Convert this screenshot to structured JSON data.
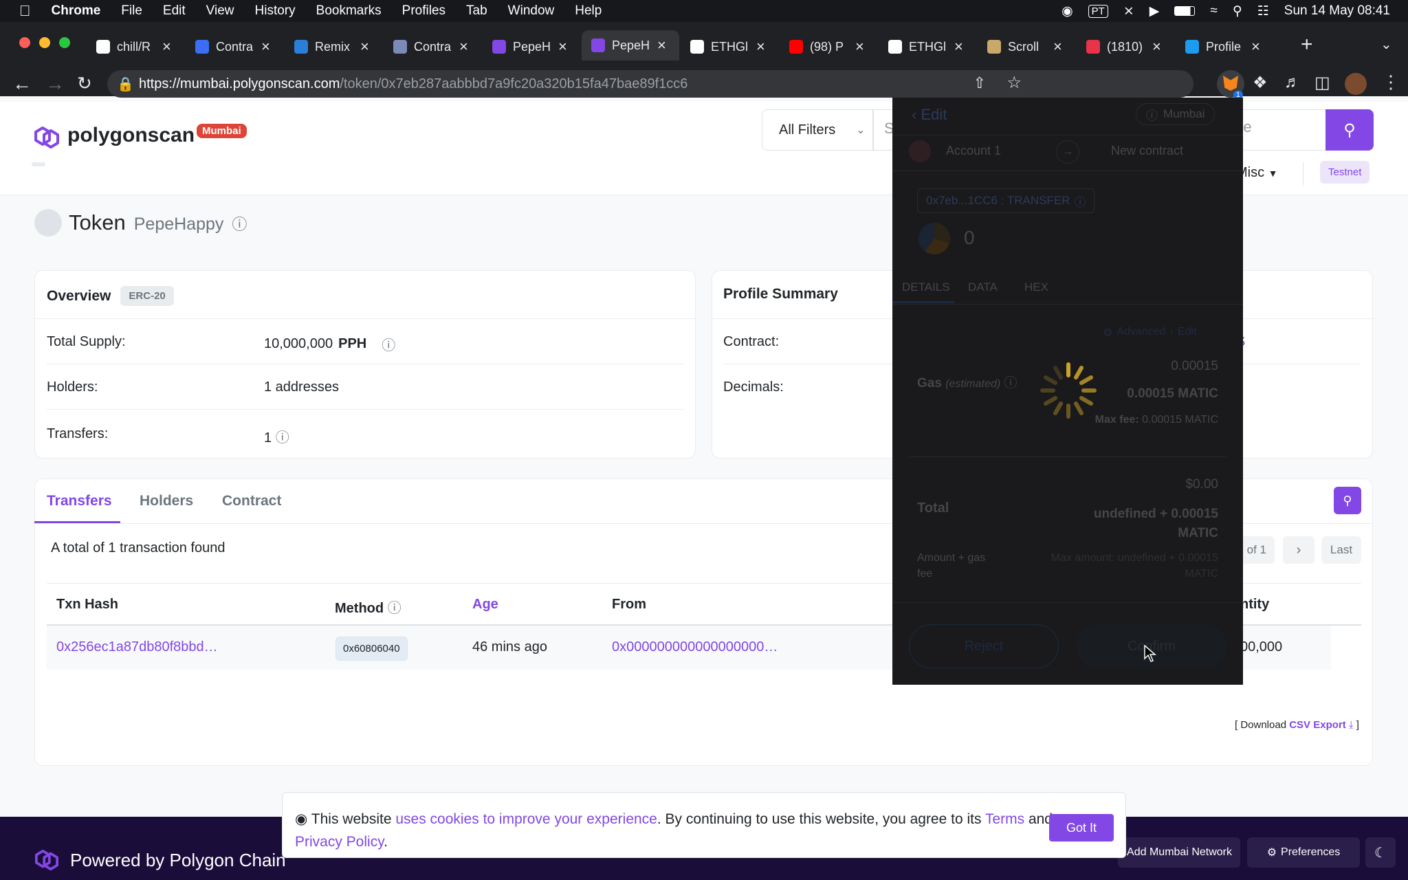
{
  "macos": {
    "app": "Chrome",
    "menus": [
      "File",
      "Edit",
      "View",
      "History",
      "Bookmarks",
      "Profiles",
      "Tab",
      "Window",
      "Help"
    ],
    "input_source": "PT",
    "datetime": "Sun 14 May  08:41"
  },
  "tabs": [
    {
      "title": "chill/R",
      "color": "#ffffff"
    },
    {
      "title": "Contra",
      "color": "#3b6ef5"
    },
    {
      "title": "Remix",
      "color": "#2b7fd9"
    },
    {
      "title": "Contra",
      "color": "#7b8ab8"
    },
    {
      "title": "PepeH",
      "color": "#8247e5"
    },
    {
      "title": "PepeH",
      "color": "#8247e5"
    },
    {
      "title": "ETHGl",
      "color": "#ffffff"
    },
    {
      "title": "(98) P",
      "color": "#ff0000"
    },
    {
      "title": "ETHGl",
      "color": "#ffffff"
    },
    {
      "title": "Scroll",
      "color": "#c9a86a"
    },
    {
      "title": "(1810)",
      "color": "#e8334a"
    },
    {
      "title": "Profile",
      "color": "#1d9bf0"
    }
  ],
  "url": {
    "host": "https://mumbai.polygonscan.com",
    "path": "/token/0x7eb287aabbbd7a9fc20a320b15fa47bae89f1cc6"
  },
  "extension_badge": "1",
  "site": {
    "logo": "polygonscan",
    "network_badge": "Mumbai",
    "filter_label": "All Filters",
    "search_partial_left": "S",
    "search_partial_right": "me",
    "nav_misc": "Misc",
    "testnet_label": "Testnet"
  },
  "token": {
    "heading": "Token",
    "name": "PepeHappy"
  },
  "overview": {
    "title": "Overview",
    "badge": "ERC-20",
    "total_supply_label": "Total Supply:",
    "total_supply_value": "10,000,000",
    "total_supply_unit": "PPH",
    "holders_label": "Holders:",
    "holders_value": "1 addresses",
    "transfers_label": "Transfers:",
    "transfers_value": "1"
  },
  "profile": {
    "title": "Profile Summary",
    "contract_label": "Contract:",
    "decimals_label": "Decimals:",
    "contract_partial": "S"
  },
  "transfers_section": {
    "tabs": [
      "Transfers",
      "Holders",
      "Contract"
    ],
    "summary": "A total of 1 transaction found",
    "pager_page": "1 of 1",
    "pager_last": "Last",
    "columns": [
      "Txn Hash",
      "Method",
      "Age",
      "From",
      "ntity"
    ],
    "rows": [
      {
        "hash": "0x256ec1a87db80f8bbd…",
        "method": "0x60806040",
        "age": "46 mins ago",
        "from": "0x000000000000000000…",
        "quantity": "00,000"
      }
    ],
    "download_prefix": "[ Download ",
    "download_link": "CSV Export",
    "download_suffix": " ]"
  },
  "metamask": {
    "back_label": "Edit",
    "network": "Mumbai",
    "account": "Account 1",
    "target": "New contract",
    "contract_pill": "0x7eb...1CC6 : TRANSFER",
    "value": "0",
    "tabs": [
      "DETAILS",
      "DATA",
      "HEX"
    ],
    "advanced": "Advanced",
    "edit": "Edit",
    "gas_label": "Gas",
    "gas_estimated": "(estimated)",
    "gas_fiat": "0.00015",
    "gas_value": "0.00015 MATIC",
    "max_fee_label": "Max fee:",
    "max_fee_value": "0.00015 MATIC",
    "total_fiat": "$0.00",
    "total_label": "Total",
    "total_value_1": "undefined + 0.00015",
    "total_value_2": "MATIC",
    "amount_label_1": "Amount + gas",
    "amount_label_2": "fee",
    "max_amount_1": "Max amount: undefined + 0.00015",
    "max_amount_2": "MATIC",
    "reject": "Reject",
    "confirm": "Confirm"
  },
  "cookie": {
    "t1": "This website ",
    "l1": "uses cookies to improve your experience",
    "t2": ". By continuing to use this website, you agree to its ",
    "l2": "Terms",
    "t3": " and",
    "l3": "Privacy Policy",
    "t4": ".",
    "button": "Got It"
  },
  "footer": {
    "powered": "Powered by Polygon Chain",
    "add_network": "Add Mumbai Network",
    "preferences": "Preferences"
  }
}
